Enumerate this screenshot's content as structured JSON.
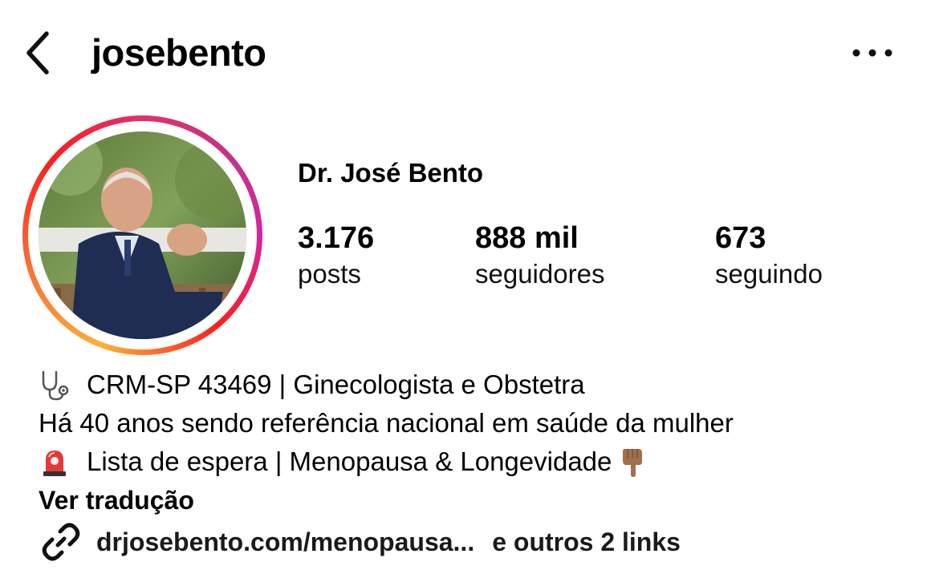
{
  "header": {
    "back_icon": "chevron-left-icon",
    "username": "josebento",
    "more_icon": "more-horizontal-icon"
  },
  "profile": {
    "display_name": "Dr. José Bento",
    "avatar_ring_colors": [
      "#fbb03b",
      "#f77737",
      "#fd1d1d",
      "#e1306c",
      "#c13584",
      "#d6249f"
    ]
  },
  "stats": [
    {
      "value": "3.176",
      "label": "posts"
    },
    {
      "value": "888 mil",
      "label": "seguidores"
    },
    {
      "value": "673",
      "label": "seguindo"
    }
  ],
  "bio": {
    "lines": [
      {
        "icon": "stethoscope-icon",
        "text": "CRM-SP 43469 | Ginecologista e Obstetra"
      },
      {
        "icon": "",
        "text": "Há 40 anos sendo referência nacional em saúde da mulher"
      },
      {
        "icon": "siren-icon",
        "text": "Lista de espera | Menopausa & Longevidade",
        "trailing_icon": "pointing-down-hand-icon"
      }
    ],
    "translate_label": "Ver tradução"
  },
  "links": {
    "icon": "link-icon",
    "primary": "drjosebento.com/menopausa...",
    "more": "e outros 2 links"
  }
}
